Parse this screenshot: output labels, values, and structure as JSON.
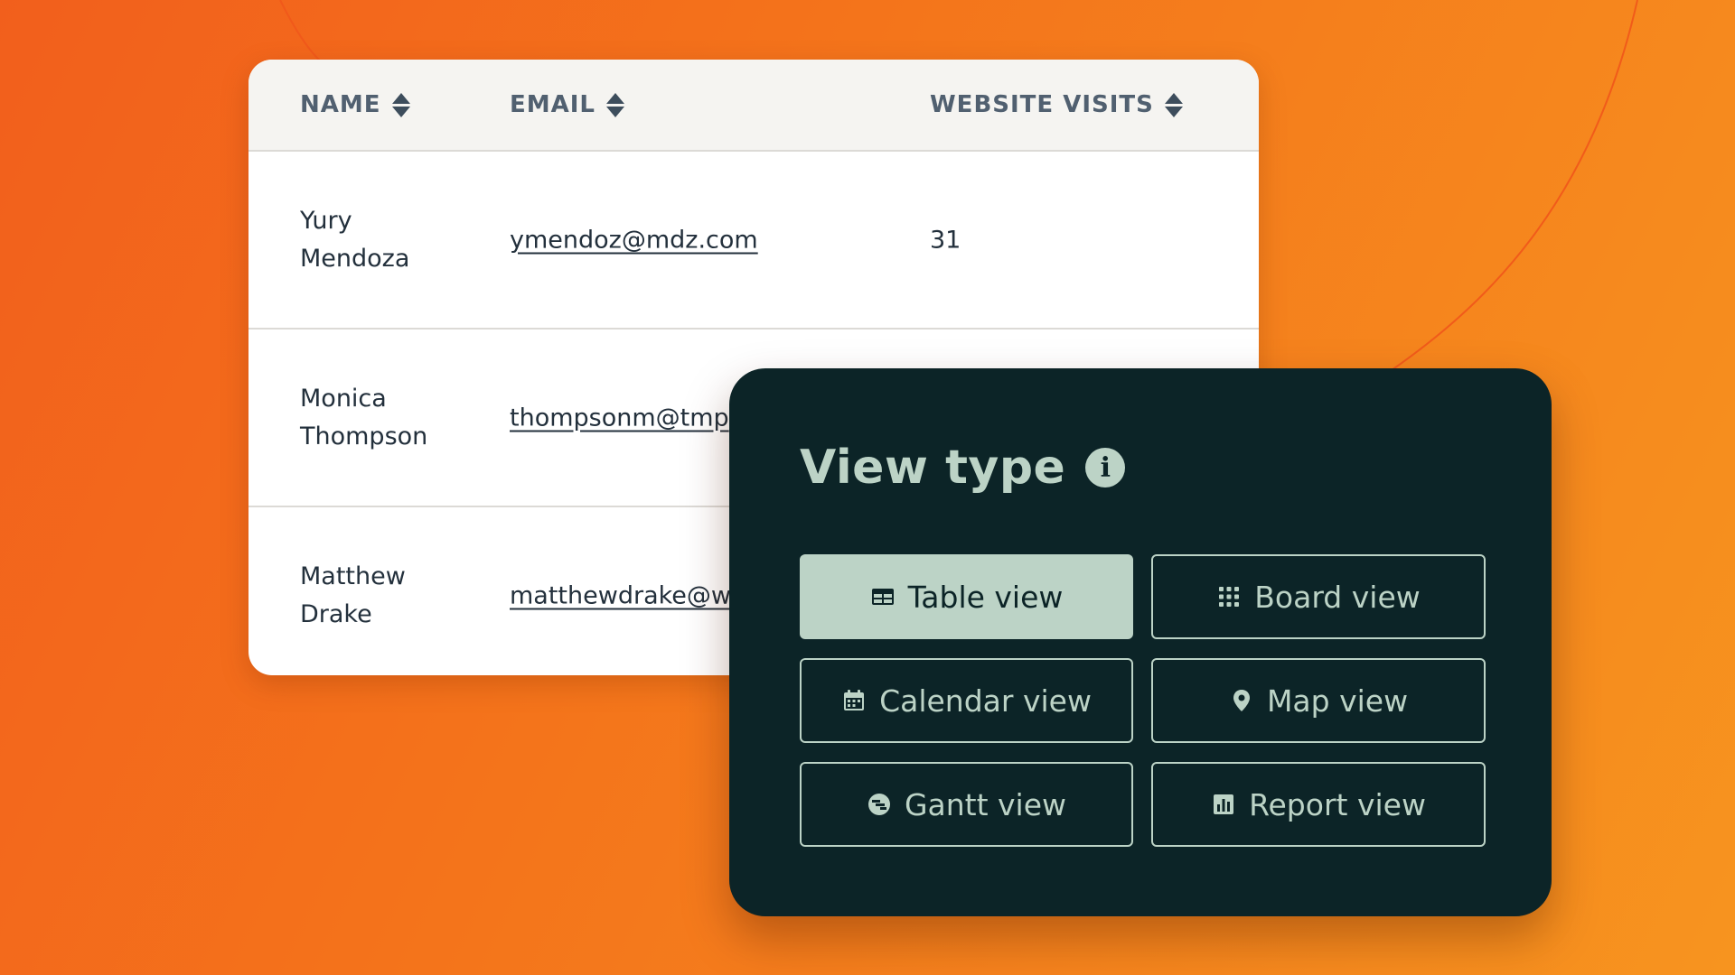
{
  "table": {
    "columns": [
      {
        "label": "NAME"
      },
      {
        "label": "EMAIL"
      },
      {
        "label": "WEBSITE VISITS"
      }
    ],
    "rows": [
      {
        "first": "Yury",
        "last": "Mendoza",
        "email": "ymendoz@mdz.com",
        "visits": "31"
      },
      {
        "first": "Monica",
        "last": "Thompson",
        "email": "thompsonm@tmp",
        "visits": ""
      },
      {
        "first": "Matthew",
        "last": "Drake",
        "email": "matthewdrake@w",
        "visits": ""
      }
    ]
  },
  "view_panel": {
    "title": "View type",
    "info_icon": "info-icon",
    "buttons": [
      {
        "label": "Table view",
        "icon": "table-icon",
        "active": true
      },
      {
        "label": "Board view",
        "icon": "grid-icon",
        "active": false
      },
      {
        "label": "Calendar view",
        "icon": "calendar-icon",
        "active": false
      },
      {
        "label": "Map view",
        "icon": "map-pin-icon",
        "active": false
      },
      {
        "label": "Gantt view",
        "icon": "gantt-icon",
        "active": false
      },
      {
        "label": "Report view",
        "icon": "bar-chart-icon",
        "active": false
      }
    ]
  },
  "colors": {
    "background_start": "#f25f1c",
    "background_end": "#f7941f",
    "panel_bg": "#0c2427",
    "panel_accent": "#bcd3c6",
    "header_text": "#516070"
  }
}
